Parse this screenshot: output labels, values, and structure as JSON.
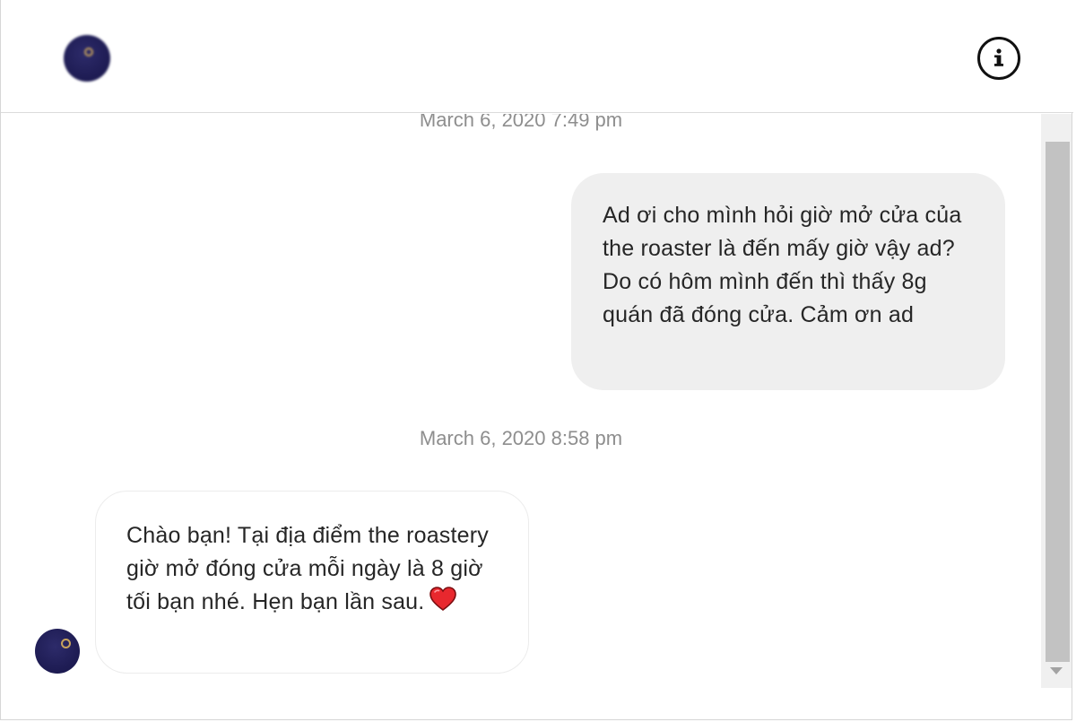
{
  "header": {
    "avatar": "profile-avatar",
    "info_icon": "info-icon",
    "info_glyph": "i"
  },
  "thread": {
    "messages": [
      {
        "timestamp": "March 6, 2020 7:49 pm",
        "direction": "outgoing",
        "text": "Ad ơi cho mình hỏi giờ mở cửa của the roaster là đến mấy giờ vậy ad? Do có hôm mình đến thì thấy 8g quán đã đóng cửa. Cảm ơn ad"
      },
      {
        "timestamp": "March 6, 2020 8:58 pm",
        "direction": "incoming",
        "text": "Chào bạn! Tại địa điểm the roastery giờ mở đóng cửa mỗi ngày là 8 giờ tối bạn nhé. Hẹn bạn lần sau.",
        "emoji": "red-heart-icon"
      }
    ]
  },
  "colors": {
    "outgoing_bubble": "#efefef",
    "incoming_bubble": "#ffffff",
    "timestamp_text": "#8e8e8e",
    "avatar": "#1f1d55"
  }
}
